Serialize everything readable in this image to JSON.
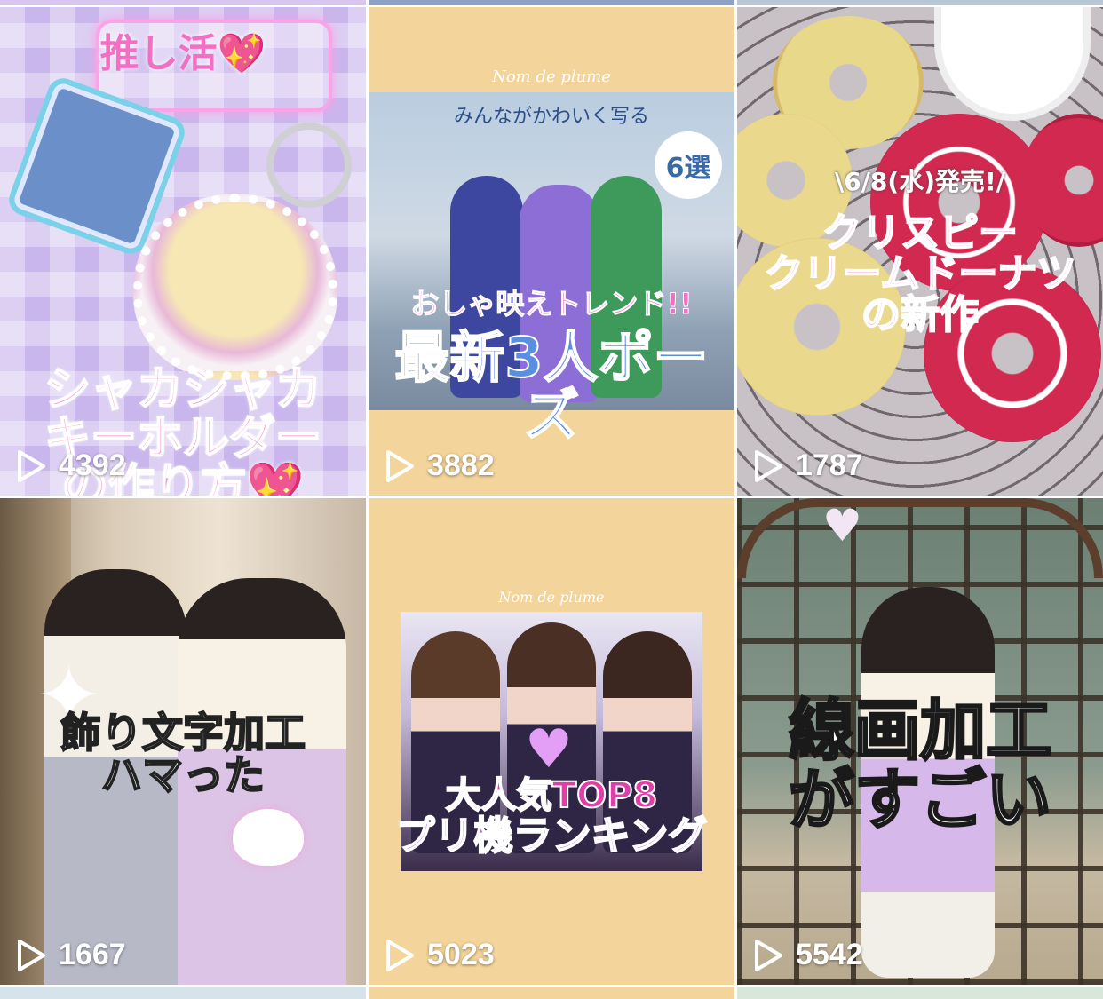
{
  "tiles": [
    {
      "title_lines": [
        "シャカシャカ",
        "キーホルダー",
        "の作り方💖"
      ],
      "badge": "推し活💖",
      "views": "4392"
    },
    {
      "brand": "Nom de plume",
      "caption": "みんながかわいく写る",
      "badge": "6選",
      "subtitle": "おしゃ映えトレンド!!",
      "title": "最新3人ポーズ",
      "views": "3882"
    },
    {
      "date": "\\6/8(水)発売!/",
      "title_lines": [
        "クリスピー",
        "クリームドーナツ",
        "の新作"
      ],
      "views": "1787"
    },
    {
      "title_lines": [
        "飾り文字加工",
        "ハマった"
      ],
      "views": "1667"
    },
    {
      "brand": "Nom de plume",
      "title": "大人気TOP8",
      "subtitle": "プリ機ランキング",
      "views": "5023"
    },
    {
      "title_lines": [
        "線画加工",
        "がすごい"
      ],
      "views": "5542"
    }
  ],
  "icons": {
    "play": "play-icon"
  },
  "colors": {
    "pink_text": "#f59ad0",
    "beige_bg": "#f3d49a",
    "purple_check": "#c9b6ec"
  }
}
